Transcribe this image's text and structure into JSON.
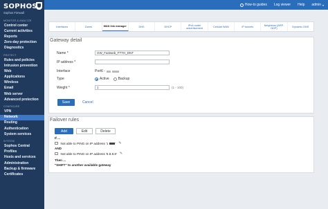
{
  "sidebar": {
    "brand": "SOPHOS",
    "brand_sub": "Sophos Firewall",
    "sections": [
      {
        "heading": "MONITOR & ANALYZE",
        "items": [
          "Control center",
          "Current activities",
          "Reports",
          "Zero-day protection",
          "Diagnostics"
        ]
      },
      {
        "heading": "PROTECT",
        "items": [
          "Rules and policies",
          "Intrusion prevention",
          "Web",
          "Applications",
          "Wireless",
          "Email",
          "Web server",
          "Advanced protection"
        ]
      },
      {
        "heading": "CONFIGURE",
        "items": [
          "VPN",
          "Network",
          "Routing",
          "Authentication",
          "System services"
        ]
      },
      {
        "heading": "SYSTEM",
        "items": [
          "Sophos Central",
          "Profiles",
          "Hosts and services",
          "Administration",
          "Backup & firmware",
          "Certificates"
        ]
      }
    ],
    "active_item": "Network"
  },
  "topbar": {
    "howto": "How-to guides",
    "logviewer": "Log viewer",
    "help": "Help",
    "user": "admin"
  },
  "tabs": [
    "Interfaces",
    "Zones",
    "WAN link manager",
    "DNS",
    "DHCP",
    "IPv6 router advertisement",
    "Cellular WAN",
    "IP tunnels",
    "Neighbors (ARP-NDP)",
    "Dynamic DNS"
  ],
  "active_tab": "WAN link manager",
  "gateway": {
    "title": "Gateway detail",
    "name_label": "Name *",
    "name_value": "GW_Fastweb_FTTH_DNT",
    "ip_label": "IP address *",
    "ip_value": "",
    "interface_label": "Interface",
    "interface_value": "Port6 -",
    "type_label": "Type",
    "type_active": "Active",
    "type_backup": "Backup",
    "weight_label": "Weight *",
    "weight_value": "1",
    "weight_hint": "(1 - 100)",
    "save": "Save",
    "cancel": "Cancel"
  },
  "failover": {
    "title": "Failover rules",
    "add": "Add",
    "edit": "Edit",
    "delete": "Delete",
    "if_label": "If ...",
    "rule1": "Not able to PING on IP address '1",
    "rule1_end": "'",
    "and_label": "AND",
    "rule2": "Not able to PING on IP address '8.8.8.8'",
    "then_label": "Then ...",
    "action": "\"SHIFT\" to another available gateway"
  },
  "colors": {
    "sidebar": "#1f3a5c",
    "topbar": "#2a6ebb",
    "accent": "#2a6ebb"
  }
}
